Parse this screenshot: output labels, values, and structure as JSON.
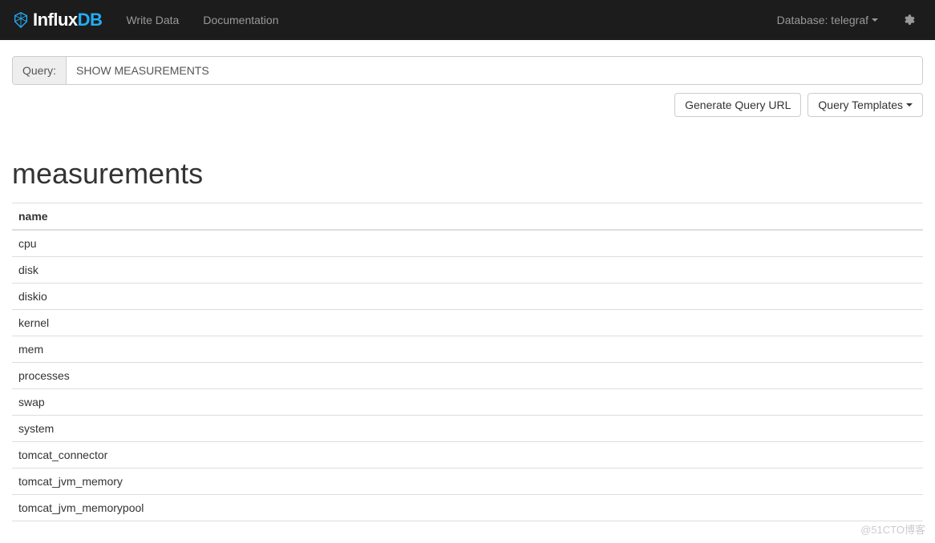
{
  "navbar": {
    "brand_prefix": "Influx",
    "brand_suffix": "DB",
    "links": {
      "write_data": "Write Data",
      "documentation": "Documentation"
    },
    "database_label": "Database: telegraf"
  },
  "query": {
    "label": "Query:",
    "value": "SHOW MEASUREMENTS"
  },
  "actions": {
    "generate_url": "Generate Query URL",
    "query_templates": "Query Templates"
  },
  "results": {
    "title": "measurements",
    "column_header": "name",
    "rows": [
      "cpu",
      "disk",
      "diskio",
      "kernel",
      "mem",
      "processes",
      "swap",
      "system",
      "tomcat_connector",
      "tomcat_jvm_memory",
      "tomcat_jvm_memorypool"
    ]
  },
  "watermark": "@51CTO博客"
}
